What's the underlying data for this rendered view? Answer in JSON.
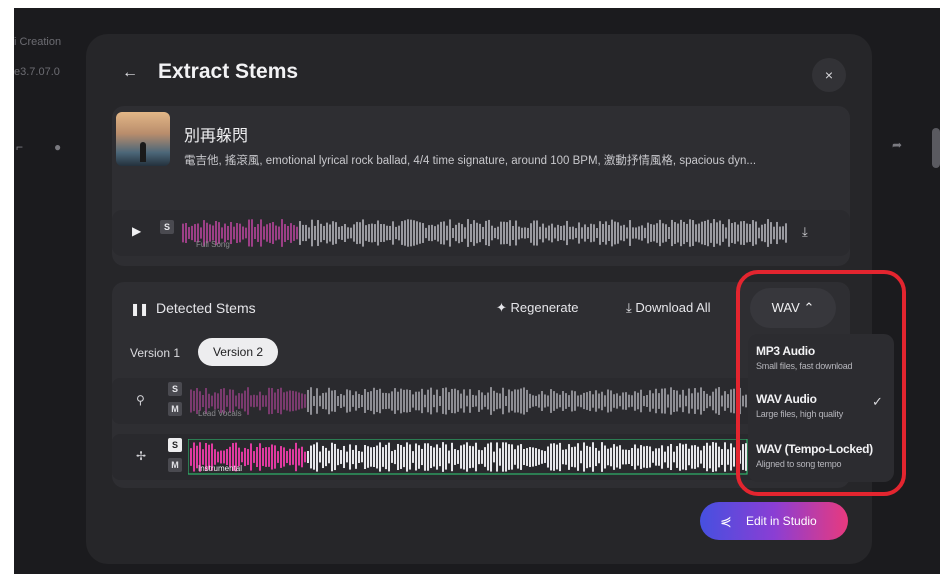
{
  "background": {
    "left_texts": [
      "",
      "i Creation",
      "e3.7.07.0"
    ]
  },
  "modal": {
    "title": "Extract Stems",
    "back_icon": "←",
    "close_icon": "×"
  },
  "song": {
    "title": "別再躲閃",
    "description": "電吉他, 搖滾風, emotional lyrical rock ballad, 4/4 time signature, around 100 BPM, 激動抒情風格, spacious dyn...",
    "full_song_label": "Full Song",
    "solo_badge": "S"
  },
  "stems": {
    "header": "Detected Stems",
    "regenerate": "Regenerate",
    "download_all": "Download All",
    "versions": [
      "Version 1",
      "Version 2"
    ],
    "selected_version": "Version 2",
    "rows": [
      {
        "label": "Lead Vocals",
        "solo": "S",
        "mute": "M"
      },
      {
        "label": "Instrumental",
        "solo": "S",
        "mute": "M"
      }
    ]
  },
  "format": {
    "selected": "WAV",
    "options": [
      {
        "title": "MP3 Audio",
        "subtitle": "Small files, fast download"
      },
      {
        "title": "WAV Audio",
        "subtitle": "Large files, high quality"
      },
      {
        "title": "WAV (Tempo-Locked)",
        "subtitle": "Aligned to song tempo"
      }
    ]
  },
  "studio_button": "Edit in Studio",
  "colors": {
    "accent_pink": "#e03aa0",
    "highlight_red": "#e3252f",
    "instrumental_border": "#2fb56a"
  }
}
